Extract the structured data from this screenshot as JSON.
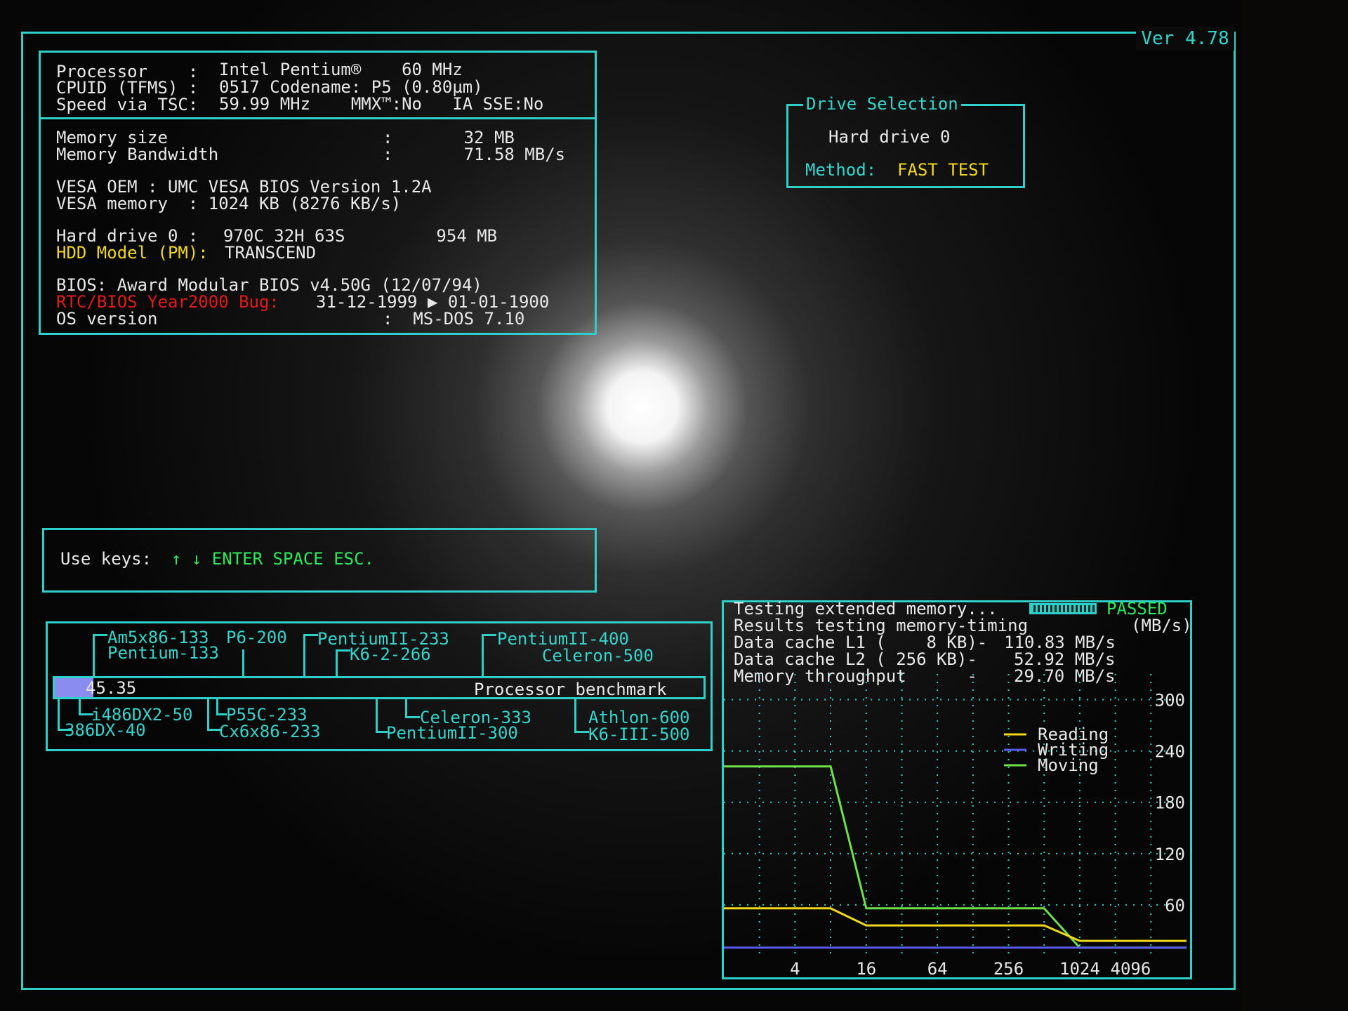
{
  "version": "Ver 4.78",
  "system_info": {
    "processor_label": "Processor    : ",
    "processor_value": "Intel Pentium®    60 MHz",
    "cpuid_label": "CPUID (TFMS) : ",
    "cpuid_value": "0517 Codename: P5 (0.80µm)",
    "speed_label": "Speed via TSC: ",
    "speed_value": "59.99 MHz    MMX™:No   IA SSE:No",
    "memory_size_label": "Memory size",
    "memory_size_value": ":       32 MB",
    "memory_bw_label": "Memory Bandwidth",
    "memory_bw_value": ":       71.58 MB/s",
    "vesa_oem": "VESA OEM : UMC VESA BIOS Version 1.2A",
    "vesa_memory": "VESA memory  : 1024 KB (8276 KB/s)",
    "hdd_label": "Hard drive 0 : ",
    "hdd_value": "970C 32H 63S         954 MB",
    "hdd_model_label": "HDD Model (PM): ",
    "hdd_model_value": "TRANSCEND",
    "bios": "BIOS: Award Modular BIOS v4.50G (12/07/94)",
    "y2k_label": "RTC/BIOS Year2000 Bug: ",
    "y2k_value": "31-12-1999 ▶ 01-01-1900",
    "os_label": "OS version",
    "os_value": ":  MS-DOS 7.10"
  },
  "drive_selection": {
    "title": "Drive Selection",
    "drive": "Hard drive 0",
    "method_label": "Method: ",
    "method_value": "FAST TEST"
  },
  "keys_panel": {
    "label": "Use keys: ",
    "keys": "↑ ↓ ENTER SPACE ESC."
  },
  "benchmark": {
    "score": "45.35",
    "title": "Processor benchmark",
    "score_fill_fraction": 0.06,
    "cpus_top": [
      "Am5x86-133",
      "P6-200",
      "Pentium-133",
      "PentiumII-233",
      "K6-2-266",
      "PentiumII-400",
      "Celeron-500"
    ],
    "cpus_bottom": [
      "i486DX2-50",
      "386DX-40",
      "P55C-233",
      "Cx6x86-233",
      "Celeron-333",
      "PentiumII-300",
      "Athlon-600",
      "K6-III-500"
    ]
  },
  "memory_test": {
    "status_label": "Testing extended memory...",
    "status_value": "PASSED",
    "results_title": "Results testing memory-timing",
    "unit": "(MB/s)",
    "l1_label": "Data cache L1 (    8 KB)-",
    "l1_value": "110.83 MB/s",
    "l2_label": "Data cache L2 ( 256 KB)-",
    "l2_value": "52.92 MB/s",
    "throughput_label": "Memory throughput      -",
    "throughput_value": "29.70 MB/s"
  },
  "chart_data": {
    "type": "line",
    "x": [
      1,
      4,
      8,
      16,
      32,
      64,
      128,
      256,
      512,
      1024,
      2048,
      4096,
      8192
    ],
    "x_ticks": [
      "4",
      "16",
      "64",
      "256",
      "1024",
      "4096"
    ],
    "y_ticks": [
      "60",
      "120",
      "180",
      "240",
      "300"
    ],
    "ylim": [
      0,
      330
    ],
    "xscale": "log2",
    "legend": [
      "Reading",
      "Writing",
      "Moving"
    ],
    "legend_placement": "top-right",
    "grid": true,
    "series": [
      {
        "name": "Moving",
        "color": "#6fe04a",
        "values": [
          222,
          222,
          222,
          56,
          56,
          56,
          56,
          56,
          56,
          10,
          10,
          10,
          10
        ]
      },
      {
        "name": "Reading",
        "color": "#f2d81a",
        "values": [
          56,
          56,
          56,
          36,
          36,
          36,
          36,
          36,
          36,
          18,
          18,
          18,
          18
        ]
      },
      {
        "name": "Writing",
        "color": "#5a5ae8",
        "values": [
          10,
          10,
          10,
          10,
          10,
          10,
          10,
          10,
          10,
          10,
          10,
          10,
          10
        ]
      }
    ]
  }
}
